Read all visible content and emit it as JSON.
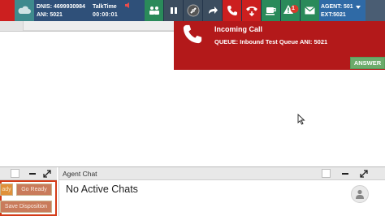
{
  "toolbar": {
    "dnis_label": "DNIS: 4699930984",
    "ani_label": "ANI: 5021",
    "talktime_label": "TalkTime",
    "talktime_value": "00:00:01",
    "alert_count": "1",
    "agent_label": "AGENT: 501",
    "ext_label": "EXT:5021",
    "icons": [
      "cloud-icon",
      "speaker-icon",
      "team-icon",
      "pause-icon",
      "record-icon",
      "transfer-icon",
      "phone-icon",
      "hangup-icon",
      "coffee-icon",
      "alert-icon",
      "mail-icon"
    ],
    "colors": {
      "bar": "#2f5079",
      "green": "#2a8a5a",
      "red": "#cc1f1f",
      "agent": "#2f6aa6"
    }
  },
  "incoming_call": {
    "title": "Incoming Call",
    "queue": "QUEUE: Inbound Test Queue ANI: 5021",
    "answer_label": "ANSWER",
    "background": "#b3191a"
  },
  "left_panel": {
    "ready_label": "ady",
    "go_ready_label": "Go Ready",
    "save_disposition_label": "Save Disposition"
  },
  "agent_chat": {
    "title": "Agent Chat",
    "empty_text": "No Active Chats"
  }
}
